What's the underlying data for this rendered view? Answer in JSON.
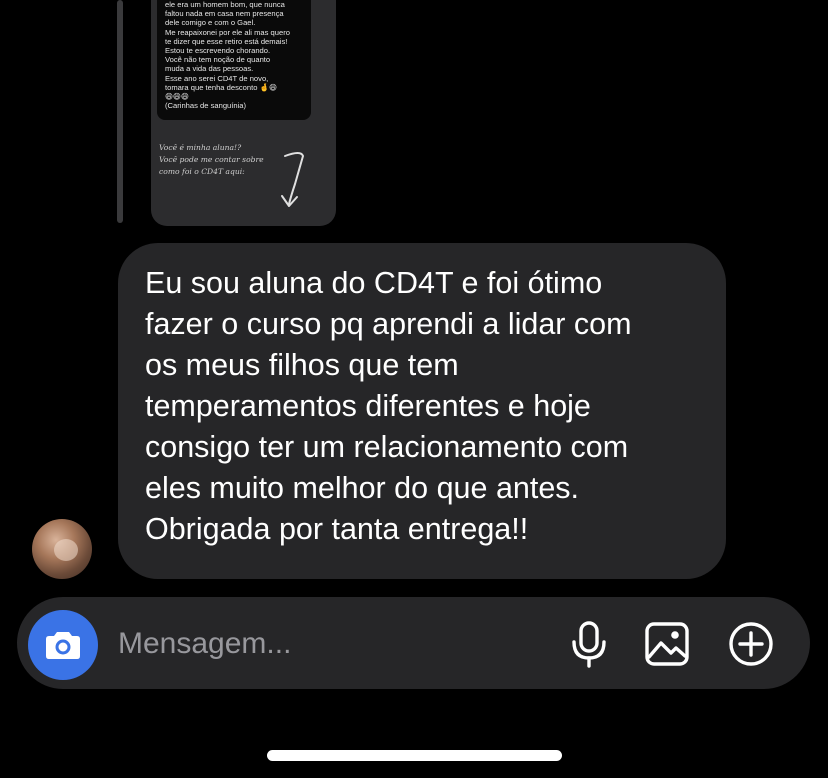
{
  "story_reply": {
    "caption_lines": [
      "ele era um homem bom, que nunca",
      "faltou nada em casa nem presença",
      "dele comigo e com o Gael.",
      "Me reapaixonei por ele ali mas quero",
      "te dizer que esse retiro está demais!",
      "Estou te escrevendo chorando.",
      "Você não tem noção de quanto",
      "muda a vida das pessoas.",
      "Esse ano serei CD4T de novo,",
      "tomara que tenha desconto 🤞😄",
      "😄😄😄",
      "(Carinhas de sanguínia)"
    ],
    "footer_lines": [
      "Você é minha aluna!?",
      "Você pode me contar sobre",
      "como foi o CD4T aqui:"
    ]
  },
  "message": {
    "lines": [
      "Eu sou aluna do CD4T e foi ótimo",
      "fazer o curso pq aprendi a lidar com",
      "os meus filhos que tem",
      "temperamentos diferentes e hoje",
      "consigo ter um relacionamento com",
      "eles muito melhor do que antes.",
      "Obrigada por tanta entrega!!"
    ]
  },
  "composer": {
    "placeholder": "Mensagem...",
    "camera_icon": "camera-icon",
    "mic_icon": "microphone-icon",
    "gallery_icon": "image-icon",
    "plus_icon": "plus-circle-icon"
  },
  "colors": {
    "background": "#000000",
    "bubble": "#262628",
    "camera_button": "#3a73e6",
    "placeholder": "#98989d"
  }
}
